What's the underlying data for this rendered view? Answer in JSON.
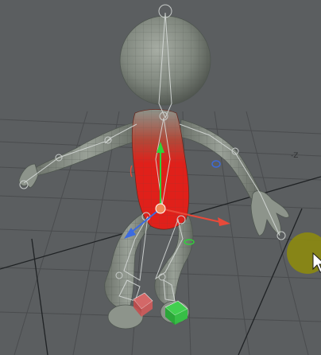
{
  "viewport": {
    "background_color": "#5b5e60",
    "grid_color": "#4a4c4e",
    "axis_labels": {
      "z_axis": "-Z"
    }
  },
  "character": {
    "mesh_color": "#8d948b",
    "wire_color": "#4f5650",
    "selected_region_color": "#e0201a",
    "bone_color": "#d6dad8"
  },
  "manipulator": {
    "x_axis_color": "#e84a3a",
    "y_axis_color": "#2fd33a",
    "z_axis_color": "#3c6be0",
    "pivot_color": "#f08a5a"
  },
  "handles": {
    "left_foot_color": "#e86a6a",
    "right_foot_color": "#3ad64a"
  },
  "cursor": {
    "highlight_color": "#8c8a10",
    "icon": "arrow-cursor-icon"
  }
}
